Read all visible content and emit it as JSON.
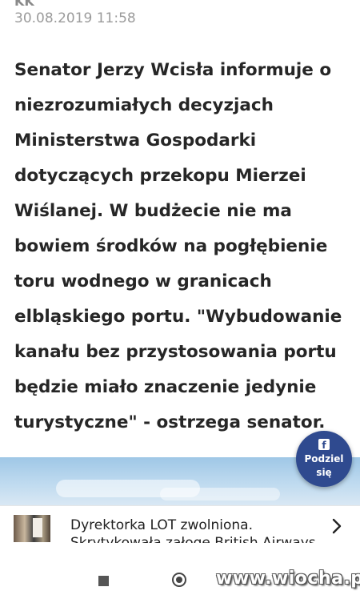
{
  "meta": {
    "author_cut": "KK",
    "date": "30.08.2019 11:58"
  },
  "article": {
    "lead": "Senator Jerzy Wcisła informuje o niezrozumiałych decyzjach Ministerstwa Gospodarki dotyczących przekopu Mierzei Wiślanej. W budżecie nie ma bowiem środków na pogłębienie toru wodnego w granicach elbląskiego portu. \"Wybudowanie kanału bez przystosowania portu będzie miało znaczenie jedynie turystyczne\" - ostrzega senator."
  },
  "share": {
    "icon": "facebook-icon",
    "label": "Podziel się",
    "color": "#2f4a8f"
  },
  "related": {
    "title": "Dyrektorka LOT zwolniona. Skrytykowała załogę British Airways",
    "arrow_icon": "chevron-right-icon"
  },
  "nav": {
    "icons": [
      "stop-icon",
      "home-icon"
    ]
  },
  "watermark": "www.wiocha.pl"
}
